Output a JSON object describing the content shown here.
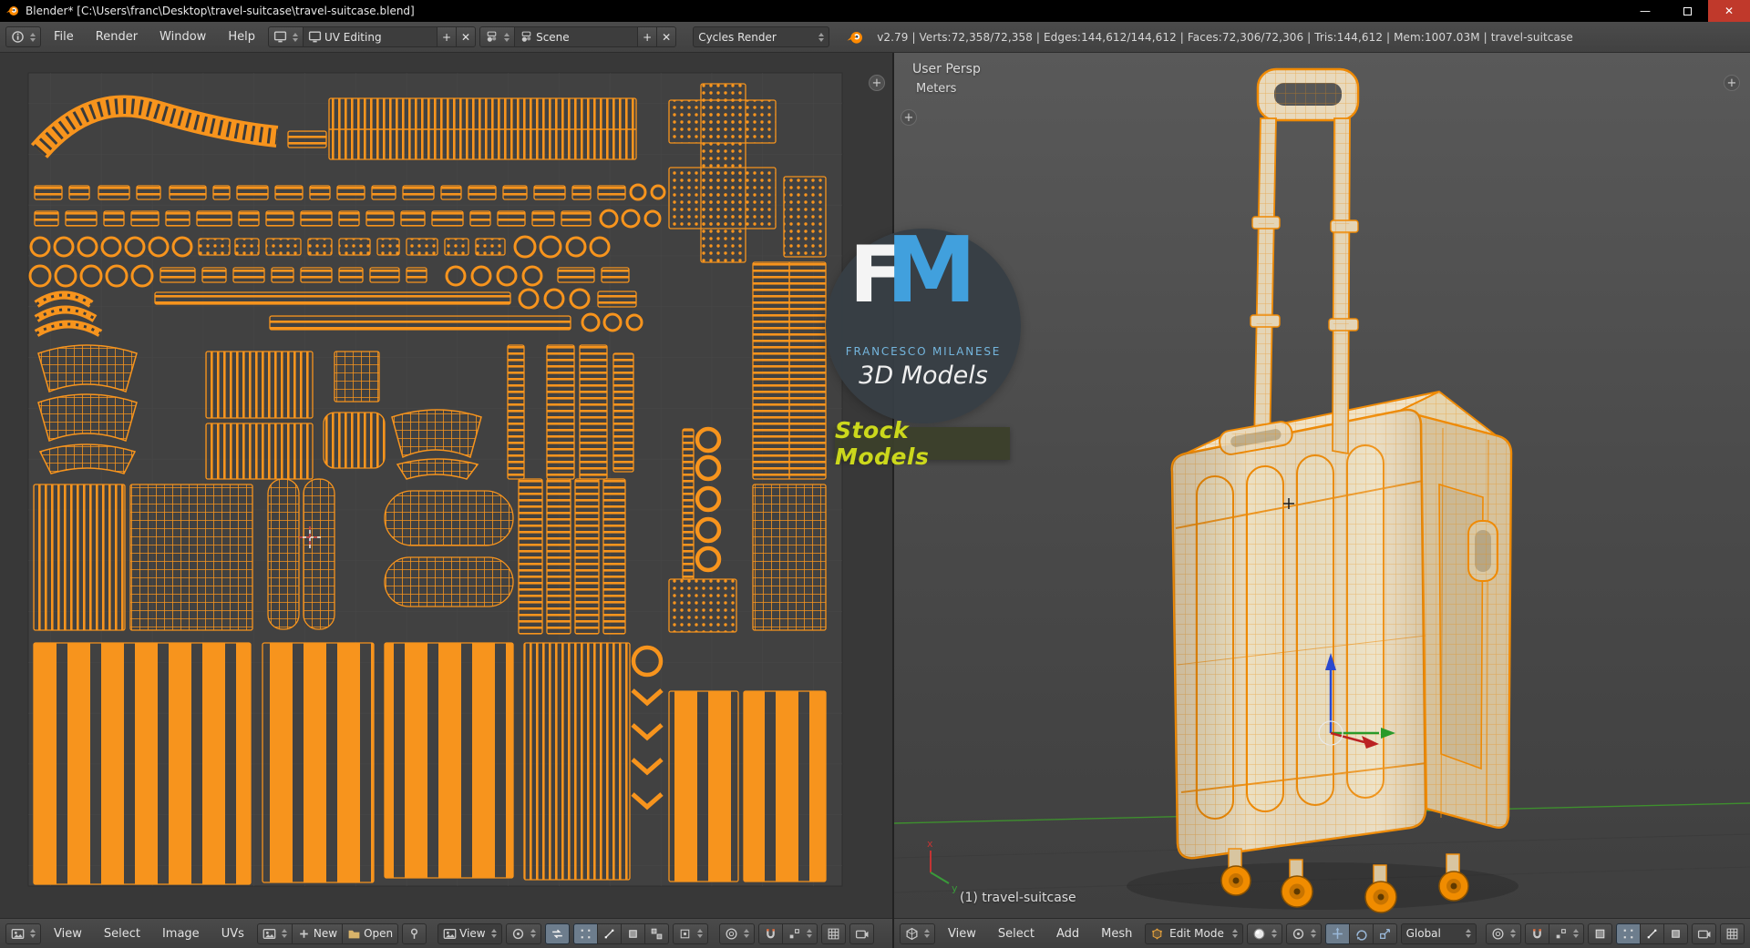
{
  "titlebar": {
    "title": "Blender* [C:\\Users\\franc\\Desktop\\travel-suitcase\\travel-suitcase.blend]"
  },
  "glyphs": {
    "plus": "+",
    "x": "✕",
    "minimize": "—",
    "close": "✕"
  },
  "topbar": {
    "menus": [
      "File",
      "Render",
      "Window",
      "Help"
    ],
    "layout": {
      "value": "UV Editing"
    },
    "scene": {
      "value": "Scene"
    },
    "engine": "Cycles Render",
    "stats": "v2.79 | Verts:72,358/72,358 | Edges:144,612/144,612 | Faces:72,306/72,306 | Tris:144,612 | Mem:1007.03M | travel-suitcase"
  },
  "uv_editor": {
    "menus": [
      "View",
      "Select",
      "Image",
      "UVs"
    ],
    "new_label": "New",
    "open_label": "Open",
    "mode_label": "View"
  },
  "viewport": {
    "persp_label": "User Persp",
    "unit_label": "Meters",
    "object_label": "(1) travel-suitcase",
    "menus": [
      "View",
      "Select",
      "Add",
      "Mesh"
    ],
    "mode_label": "Edit Mode",
    "orientation_label": "Global"
  },
  "watermark": {
    "f": "F",
    "m": "M",
    "name": "FRANCESCO MILANESE",
    "tagline": "3D Models",
    "banner": "Stock Models"
  },
  "icons": {
    "info-icon": "circled i",
    "image-icon": "picture",
    "screen-icon": "monitor",
    "scene-icon": "scene spheres",
    "folder-icon": "open folder",
    "pin-icon": "pin",
    "pivot-icon": "dot in circle",
    "sync-icon": "two arrows",
    "vertex-icon": "corner dots",
    "edge-icon": "edge line",
    "face-icon": "filled quad",
    "island-icon": "two quads",
    "sticky-icon": "square dot",
    "proportional-icon": "concentric circles",
    "magnet-icon": "horseshoe magnet",
    "snap-element-icon": "squares",
    "camera-icon": "camera",
    "grid-icon": "grid",
    "view3d-icon": "wire cube",
    "cube-icon": "edit cube",
    "sphere-icon": "shaded ball",
    "translate-icon": "cross arrows",
    "rotate-icon": "arc arrow",
    "scale-icon": "box arrow",
    "occlude-icon": "filled square",
    "blender-icon": "blender logo"
  },
  "colors": {
    "accent_orange": "#f7941d",
    "header_bg": "#454545",
    "uv_bg": "#404040",
    "suitcase_fill": "#e8dabd",
    "axis_green": "#3e8f2e",
    "logo_blue": "#41a0dd",
    "banner_text": "#ccd81c"
  }
}
